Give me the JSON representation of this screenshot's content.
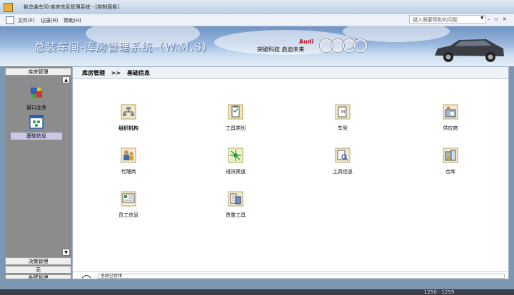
{
  "window": {
    "title": "新总装车间-库房信息管理系统 - [控制面板]"
  },
  "menu": {
    "items": [
      "文件(F)",
      "记录(R)",
      "帮助(H)"
    ],
    "search_placeholder": "键入需要帮助的问题",
    "window_buttons": [
      "–",
      "▫",
      "✕"
    ]
  },
  "banner": {
    "title": "总装车间-库房管理系统（W.M.S）",
    "slogan": "突破科技  启迪未来",
    "brand": "Audi"
  },
  "sidebar": {
    "top_header": "库房管理",
    "items": [
      {
        "label": "窗口业务",
        "icon": "window-business-icon"
      },
      {
        "label": "基础信息",
        "icon": "basic-info-icon",
        "selected": true
      }
    ],
    "bottom_headers": [
      "决策管理",
      "无",
      "系统管理"
    ]
  },
  "breadcrumb": {
    "section": "库房管理",
    "separator": ">>",
    "page": "基础信息"
  },
  "tiles": [
    {
      "label": "组织机构",
      "icon": "organization-icon",
      "bold": true
    },
    {
      "label": "工具类别",
      "icon": "tool-category-icon"
    },
    {
      "label": "车型",
      "icon": "car-model-icon"
    },
    {
      "label": "供应商",
      "icon": "supplier-icon"
    },
    {
      "label": "代理商",
      "icon": "agent-icon"
    },
    {
      "label": "进货渠道",
      "icon": "purchase-channel-icon"
    },
    {
      "label": "工具信息",
      "icon": "tool-info-icon"
    },
    {
      "label": "仓库",
      "icon": "warehouse-icon"
    },
    {
      "label": "员工信息",
      "icon": "employee-info-icon"
    },
    {
      "label": "贵重工具",
      "icon": "valuable-tool-icon"
    }
  ],
  "status": {
    "text": "系统已就绪"
  },
  "taskbar": {
    "text": "1250  ·  1259"
  }
}
